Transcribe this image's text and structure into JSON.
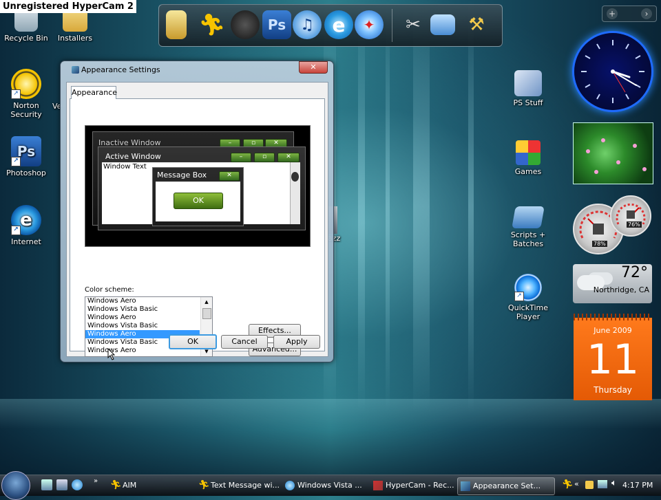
{
  "recorder": {
    "watermark": "Unregistered HyperCam 2"
  },
  "desktop": {
    "icons": [
      {
        "label": "Recycle Bin"
      },
      {
        "label": "Installers"
      },
      {
        "label": "Norton Security"
      },
      {
        "label": "Ve"
      },
      {
        "label": "Photoshop"
      },
      {
        "label": "Internet"
      },
      {
        "label": "PS Stuff"
      },
      {
        "label": "Games"
      },
      {
        "label": "Scripts + Batches"
      },
      {
        "label": "QuickTime Player"
      },
      {
        "label": "azz"
      }
    ]
  },
  "dock": {
    "items": [
      "folder",
      "aim",
      "media",
      "photoshop",
      "itunes",
      "internet-explorer",
      "safari",
      "tools",
      "computer",
      "settings"
    ]
  },
  "gadgets": {
    "cpu_meter": {
      "cpu": "78%",
      "memory": "76%"
    },
    "weather": {
      "temp": "72°",
      "location": "Northridge, CA"
    },
    "calendar": {
      "month_year": "June 2009",
      "day": "11",
      "weekday": "Thursday"
    }
  },
  "dialog": {
    "title": "Appearance Settings",
    "close_label": "✕",
    "tab": "Appearance",
    "preview": {
      "inactive_title": "Inactive Window",
      "active_title": "Active Window",
      "window_text": "Window Text",
      "message_box_title": "Message Box",
      "ok_label": "OK"
    },
    "color_scheme_label": "Color scheme:",
    "color_schemes": [
      "Windows Aero",
      "Windows Vista Basic",
      "Windows Aero",
      "Windows Vista Basic",
      "Windows Aero",
      "Windows Vista Basic",
      "Windows Aero"
    ],
    "selected_index": 4,
    "effects_label": "Effects...",
    "advanced_label": "Advanced...",
    "ok_label": "OK",
    "cancel_label": "Cancel",
    "apply_label": "Apply"
  },
  "taskbar": {
    "quick_launch_more": "»",
    "buttons": [
      {
        "label": "AIM"
      },
      {
        "label": "Text Message wi..."
      },
      {
        "label": "Windows Vista ..."
      },
      {
        "label": "HyperCam - Rec..."
      },
      {
        "label": "Appearance Set..."
      }
    ],
    "active_index": 4,
    "tray_more": "«",
    "clock": "4:17 PM"
  },
  "colors": {
    "accent": "#3399ff",
    "preview_button_green": "#5d8f22",
    "calendar_orange": "#f06a10",
    "clock_glow": "#1e6bff"
  }
}
